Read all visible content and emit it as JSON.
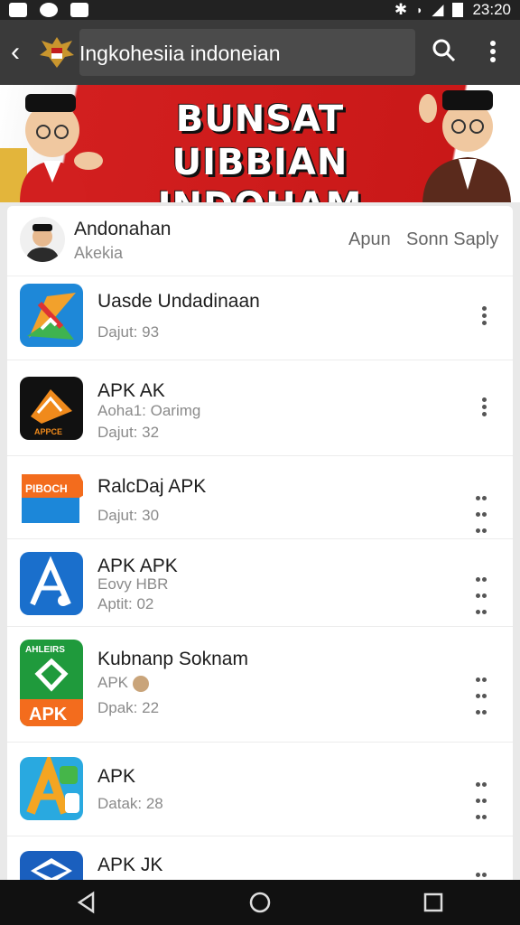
{
  "status_bar": {
    "time": "23:20"
  },
  "app_bar": {
    "search_text": "Ingkohesiia indoneian",
    "back_label": "<"
  },
  "banner": {
    "line1": "BUNSAT UIBBIAN",
    "line2": "INDOHAM IMESA"
  },
  "header": {
    "title": "Andonahan",
    "subtitle": "Akekia",
    "action1": "Apun",
    "action2": "Sonn Saply"
  },
  "apps": [
    {
      "name": "Uasde Undadinaan",
      "sub1": "",
      "sub2": "Dajut: 93",
      "icon": "map-arrow-icon"
    },
    {
      "name": "APK AK",
      "sub1": "Aoha1: Oarimg",
      "sub2": "Dajut: 32",
      "icon": "orange-envelope-icon"
    },
    {
      "name": "RalcDaj APK",
      "sub1": "",
      "sub2": "Dajut: 30",
      "icon": "orange-tag-icon"
    },
    {
      "name": "APK APK",
      "sub1": "Eovy HBR",
      "sub2": "Aptit: 02",
      "icon": "blue-a-icon"
    },
    {
      "name": "Kubnanp Soknam",
      "sub1": "APK",
      "sub2": "Dpak: 22",
      "icon": "green-apk-icon"
    },
    {
      "name": "APK",
      "sub1": "",
      "sub2": "Datak: 28",
      "icon": "colorful-a-icon"
    },
    {
      "name": "APK JK",
      "sub1": "",
      "sub2": "",
      "icon": "blue-box-icon"
    }
  ],
  "icon_texts": {
    "orange_tag": "PIBOCH",
    "green_top": "AHLEIRS",
    "green_bottom": "APK",
    "envelope_label": "APPCE"
  }
}
